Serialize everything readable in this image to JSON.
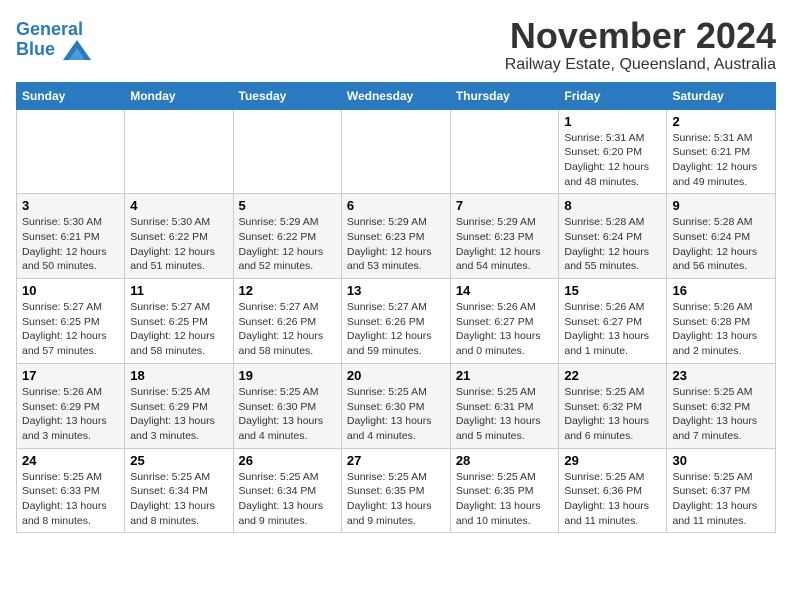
{
  "header": {
    "logo_line1": "General",
    "logo_line2": "Blue",
    "month": "November 2024",
    "location": "Railway Estate, Queensland, Australia"
  },
  "weekdays": [
    "Sunday",
    "Monday",
    "Tuesday",
    "Wednesday",
    "Thursday",
    "Friday",
    "Saturday"
  ],
  "weeks": [
    [
      {
        "day": "",
        "info": ""
      },
      {
        "day": "",
        "info": ""
      },
      {
        "day": "",
        "info": ""
      },
      {
        "day": "",
        "info": ""
      },
      {
        "day": "",
        "info": ""
      },
      {
        "day": "1",
        "info": "Sunrise: 5:31 AM\nSunset: 6:20 PM\nDaylight: 12 hours and 48 minutes."
      },
      {
        "day": "2",
        "info": "Sunrise: 5:31 AM\nSunset: 6:21 PM\nDaylight: 12 hours and 49 minutes."
      }
    ],
    [
      {
        "day": "3",
        "info": "Sunrise: 5:30 AM\nSunset: 6:21 PM\nDaylight: 12 hours and 50 minutes."
      },
      {
        "day": "4",
        "info": "Sunrise: 5:30 AM\nSunset: 6:22 PM\nDaylight: 12 hours and 51 minutes."
      },
      {
        "day": "5",
        "info": "Sunrise: 5:29 AM\nSunset: 6:22 PM\nDaylight: 12 hours and 52 minutes."
      },
      {
        "day": "6",
        "info": "Sunrise: 5:29 AM\nSunset: 6:23 PM\nDaylight: 12 hours and 53 minutes."
      },
      {
        "day": "7",
        "info": "Sunrise: 5:29 AM\nSunset: 6:23 PM\nDaylight: 12 hours and 54 minutes."
      },
      {
        "day": "8",
        "info": "Sunrise: 5:28 AM\nSunset: 6:24 PM\nDaylight: 12 hours and 55 minutes."
      },
      {
        "day": "9",
        "info": "Sunrise: 5:28 AM\nSunset: 6:24 PM\nDaylight: 12 hours and 56 minutes."
      }
    ],
    [
      {
        "day": "10",
        "info": "Sunrise: 5:27 AM\nSunset: 6:25 PM\nDaylight: 12 hours and 57 minutes."
      },
      {
        "day": "11",
        "info": "Sunrise: 5:27 AM\nSunset: 6:25 PM\nDaylight: 12 hours and 58 minutes."
      },
      {
        "day": "12",
        "info": "Sunrise: 5:27 AM\nSunset: 6:26 PM\nDaylight: 12 hours and 58 minutes."
      },
      {
        "day": "13",
        "info": "Sunrise: 5:27 AM\nSunset: 6:26 PM\nDaylight: 12 hours and 59 minutes."
      },
      {
        "day": "14",
        "info": "Sunrise: 5:26 AM\nSunset: 6:27 PM\nDaylight: 13 hours and 0 minutes."
      },
      {
        "day": "15",
        "info": "Sunrise: 5:26 AM\nSunset: 6:27 PM\nDaylight: 13 hours and 1 minute."
      },
      {
        "day": "16",
        "info": "Sunrise: 5:26 AM\nSunset: 6:28 PM\nDaylight: 13 hours and 2 minutes."
      }
    ],
    [
      {
        "day": "17",
        "info": "Sunrise: 5:26 AM\nSunset: 6:29 PM\nDaylight: 13 hours and 3 minutes."
      },
      {
        "day": "18",
        "info": "Sunrise: 5:25 AM\nSunset: 6:29 PM\nDaylight: 13 hours and 3 minutes."
      },
      {
        "day": "19",
        "info": "Sunrise: 5:25 AM\nSunset: 6:30 PM\nDaylight: 13 hours and 4 minutes."
      },
      {
        "day": "20",
        "info": "Sunrise: 5:25 AM\nSunset: 6:30 PM\nDaylight: 13 hours and 4 minutes."
      },
      {
        "day": "21",
        "info": "Sunrise: 5:25 AM\nSunset: 6:31 PM\nDaylight: 13 hours and 5 minutes."
      },
      {
        "day": "22",
        "info": "Sunrise: 5:25 AM\nSunset: 6:32 PM\nDaylight: 13 hours and 6 minutes."
      },
      {
        "day": "23",
        "info": "Sunrise: 5:25 AM\nSunset: 6:32 PM\nDaylight: 13 hours and 7 minutes."
      }
    ],
    [
      {
        "day": "24",
        "info": "Sunrise: 5:25 AM\nSunset: 6:33 PM\nDaylight: 13 hours and 8 minutes."
      },
      {
        "day": "25",
        "info": "Sunrise: 5:25 AM\nSunset: 6:34 PM\nDaylight: 13 hours and 8 minutes."
      },
      {
        "day": "26",
        "info": "Sunrise: 5:25 AM\nSunset: 6:34 PM\nDaylight: 13 hours and 9 minutes."
      },
      {
        "day": "27",
        "info": "Sunrise: 5:25 AM\nSunset: 6:35 PM\nDaylight: 13 hours and 9 minutes."
      },
      {
        "day": "28",
        "info": "Sunrise: 5:25 AM\nSunset: 6:35 PM\nDaylight: 13 hours and 10 minutes."
      },
      {
        "day": "29",
        "info": "Sunrise: 5:25 AM\nSunset: 6:36 PM\nDaylight: 13 hours and 11 minutes."
      },
      {
        "day": "30",
        "info": "Sunrise: 5:25 AM\nSunset: 6:37 PM\nDaylight: 13 hours and 11 minutes."
      }
    ]
  ]
}
